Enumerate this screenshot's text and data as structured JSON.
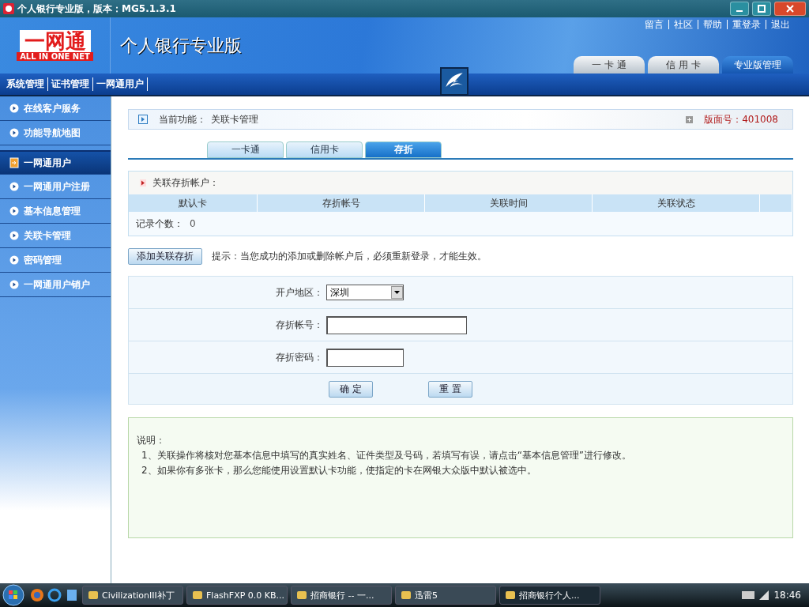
{
  "window": {
    "title": "个人银行专业版，版本：MG5.1.3.1"
  },
  "header": {
    "logo_cn": "一网通",
    "logo_en": "ALL IN ONE NET",
    "product": "个人银行专业版",
    "links": [
      "留言",
      "社区",
      "帮助",
      "重登录",
      "退出"
    ],
    "tabs": [
      {
        "label": "一 卡 通",
        "selected": false
      },
      {
        "label": "信 用 卡",
        "selected": false
      },
      {
        "label": "专业版管理",
        "selected": true
      }
    ]
  },
  "menu": [
    "系统管理",
    "证书管理",
    "一网通用户"
  ],
  "sidebar": {
    "items": [
      {
        "label": "在线客户服务",
        "selected": false
      },
      {
        "label": "功能导航地图",
        "selected": false
      },
      {
        "label": "一网通用户",
        "selected": true
      },
      {
        "label": "一网通用户注册",
        "selected": false
      },
      {
        "label": "基本信息管理",
        "selected": false
      },
      {
        "label": "关联卡管理",
        "selected": false
      },
      {
        "label": "密码管理",
        "selected": false
      },
      {
        "label": "一网通用户销户",
        "selected": false
      }
    ]
  },
  "breadcrumb": {
    "label": "当前功能：",
    "value": "关联卡管理",
    "page_no": "版面号：401008"
  },
  "tabs": [
    {
      "label": "一卡通",
      "selected": false
    },
    {
      "label": "信用卡",
      "selected": false
    },
    {
      "label": "存折",
      "selected": true
    }
  ],
  "table": {
    "title": "关联存折帐户：",
    "columns": [
      "默认卡",
      "存折帐号",
      "关联时间",
      "关联状态"
    ],
    "record_label": "记录个数：",
    "record_count": "0"
  },
  "add_button": "添加关联存折",
  "hint": "提示：当您成功的添加或删除帐户后，必须重新登录，才能生效。",
  "form": {
    "fields": [
      {
        "kind": "select",
        "label": "开户地区：",
        "value": "深圳"
      },
      {
        "kind": "text",
        "label": "存折帐号："
      },
      {
        "kind": "password",
        "label": "存折密码："
      }
    ],
    "buttons": [
      "确 定",
      "重 置"
    ]
  },
  "notes": {
    "title": "说明：",
    "lines": [
      "1、关联操作将核对您基本信息中填写的真实姓名、证件类型及号码，若填写有误，请点击“基本信息管理”进行修改。",
      "2、如果你有多张卡，那么您能使用设置默认卡功能，使指定的卡在网银大众版中默认被选中。"
    ]
  },
  "taskbar": {
    "items": [
      {
        "label": "CivilizationIII补丁",
        "selected": false
      },
      {
        "label": "FlashFXP 0.0 KB...",
        "selected": false
      },
      {
        "label": "招商银行 -- 一...",
        "selected": false
      },
      {
        "label": "迅雷5",
        "selected": false
      },
      {
        "label": "招商银行个人...",
        "selected": true
      }
    ],
    "time": "18:46"
  }
}
